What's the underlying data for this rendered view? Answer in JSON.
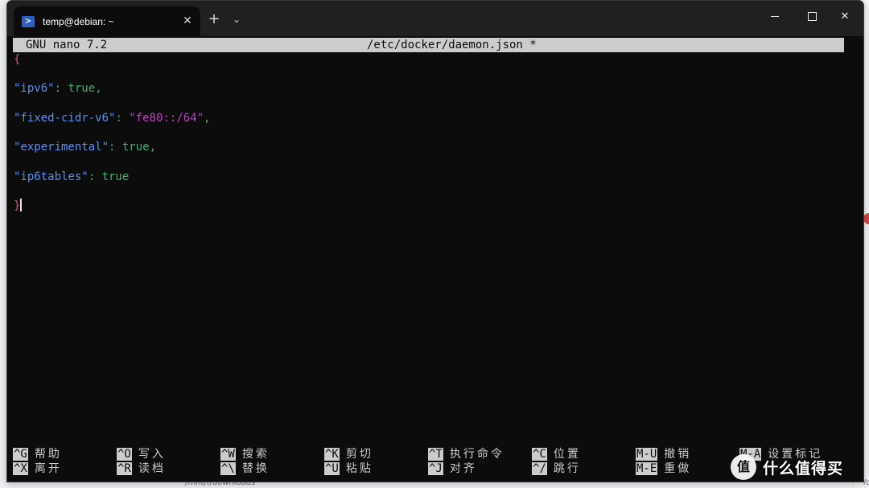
{
  "window": {
    "tab_title": "temp@debian: ~",
    "tab_icon": "powershell-terminal-icon",
    "new_tab_label": "+",
    "dropdown_label": "⌄",
    "close_tab_label": "✕",
    "close_label": "✕"
  },
  "nano": {
    "version_label": "GNU nano 7.2",
    "file_title": "/etc/docker/daemon.json *",
    "lines": [
      [
        {
          "t": "{",
          "c": "brace"
        }
      ],
      [],
      [
        {
          "t": "\"ipv6\"",
          "c": "key"
        },
        {
          "t": ": ",
          "c": "punct"
        },
        {
          "t": "true",
          "c": "bool"
        },
        {
          "t": ",",
          "c": "punct"
        }
      ],
      [],
      [
        {
          "t": "\"fixed-cidr-v6\"",
          "c": "key"
        },
        {
          "t": ": ",
          "c": "punct"
        },
        {
          "t": "\"fe80::/64\"",
          "c": "str"
        },
        {
          "t": ",",
          "c": "punct"
        }
      ],
      [],
      [
        {
          "t": "\"experimental\"",
          "c": "key"
        },
        {
          "t": ": ",
          "c": "punct"
        },
        {
          "t": "true",
          "c": "bool"
        },
        {
          "t": ",",
          "c": "punct"
        }
      ],
      [],
      [
        {
          "t": "\"ip6tables\"",
          "c": "key"
        },
        {
          "t": ": ",
          "c": "punct"
        },
        {
          "t": "true",
          "c": "bool"
        }
      ],
      [],
      [
        {
          "t": "}",
          "c": "brace"
        }
      ]
    ],
    "shortcuts_row1": [
      {
        "key": "^G",
        "label": "帮助"
      },
      {
        "key": "^O",
        "label": "写入"
      },
      {
        "key": "^W",
        "label": "搜索"
      },
      {
        "key": "^K",
        "label": "剪切"
      },
      {
        "key": "^T",
        "label": "执行命令"
      },
      {
        "key": "^C",
        "label": "位置"
      },
      {
        "key": "M-U",
        "label": "撤销"
      },
      {
        "key": "M-A",
        "label": "设置标记"
      }
    ],
    "shortcuts_row2": [
      {
        "key": "^X",
        "label": "离开"
      },
      {
        "key": "^R",
        "label": "读档"
      },
      {
        "key": "^\\",
        "label": "替换"
      },
      {
        "key": "^U",
        "label": "粘贴"
      },
      {
        "key": "^J",
        "label": "对齐"
      },
      {
        "key": "^/",
        "label": "跳行"
      },
      {
        "key": "M-E",
        "label": "重做"
      },
      {
        "key": "",
        "label": ""
      }
    ]
  },
  "background": {
    "bottom_path": "/mnt/f/downloads",
    "right_fragment": "You're r"
  },
  "watermark": {
    "badge": "值",
    "text": "什么值得买"
  },
  "colors": {
    "terminal_bg": "#0c0c0c",
    "brace": "#e05561",
    "key": "#5a8ff0",
    "bool": "#3cb371",
    "string": "#c43fc8"
  }
}
